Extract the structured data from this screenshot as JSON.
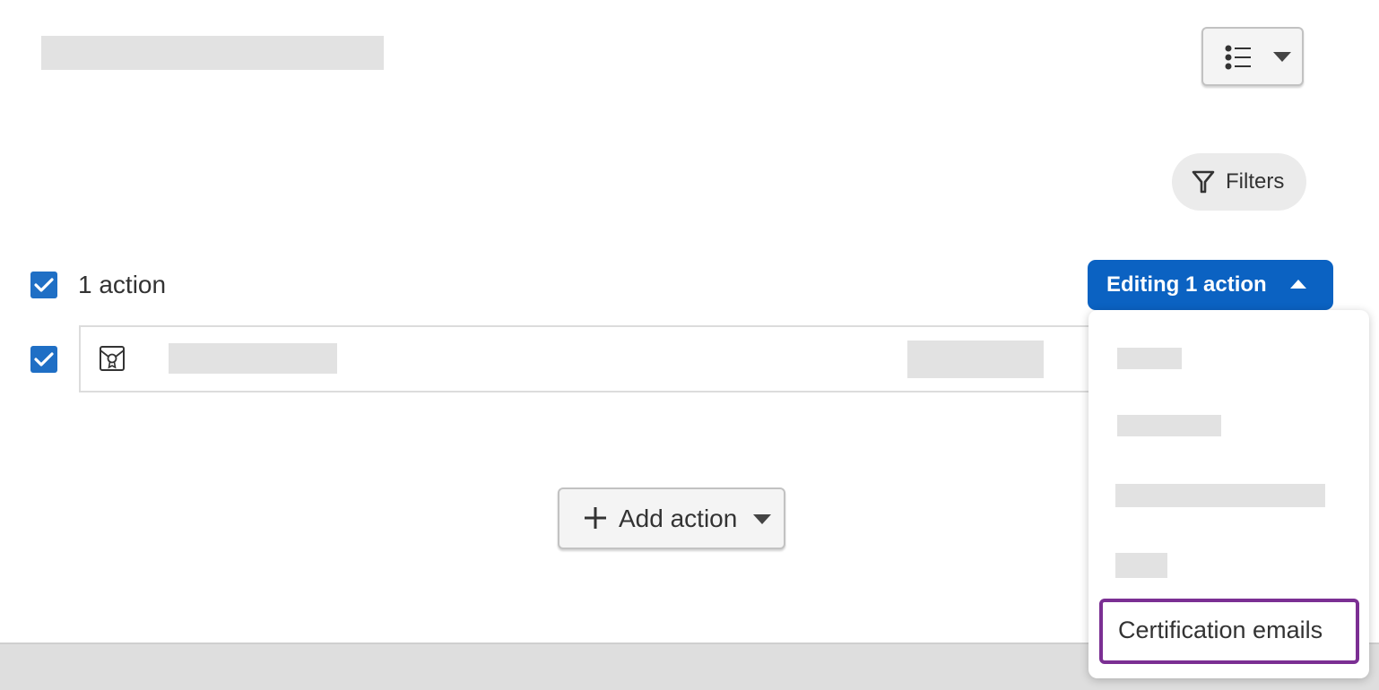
{
  "toolbar": {
    "view_toggle_icon": "list-icon",
    "filters_label": "Filters"
  },
  "selection": {
    "count_label": "1 action",
    "edit_button_label": "Editing 1 action"
  },
  "edit_menu": {
    "items": [
      {
        "label": "",
        "redacted": true
      },
      {
        "label": "",
        "redacted": true
      },
      {
        "label": "",
        "redacted": true
      },
      {
        "label": "",
        "redacted": true
      },
      {
        "label": "Certification emails",
        "redacted": false,
        "highlighted": true
      }
    ]
  },
  "actions_list": {
    "rows": [
      {
        "icon": "certificate-icon",
        "checked": true
      }
    ]
  },
  "add_action": {
    "label": "Add action"
  },
  "colors": {
    "primary": "#0b62c2",
    "checkbox": "#1f6fc5",
    "highlight_outline": "#7b2f93"
  }
}
